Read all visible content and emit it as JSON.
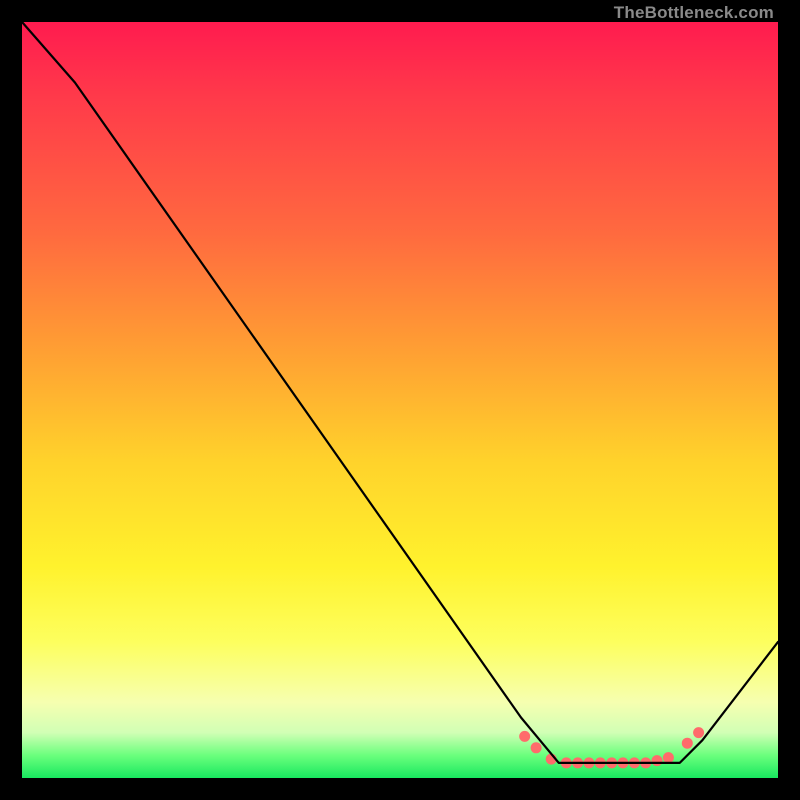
{
  "attribution": "TheBottleneck.com",
  "chart_data": {
    "type": "line",
    "title": "",
    "xlabel": "",
    "ylabel": "",
    "xlim": [
      0,
      100
    ],
    "ylim": [
      0,
      100
    ],
    "series": [
      {
        "name": "bottleneck-curve",
        "x": [
          0,
          7,
          66,
          71,
          87,
          90,
          100
        ],
        "y": [
          100,
          92,
          8,
          2,
          2,
          5,
          18
        ]
      }
    ],
    "highlight": {
      "name": "flat-minimum-dots",
      "x": [
        66.5,
        68,
        70,
        72,
        73.5,
        75,
        76.5,
        78,
        79.5,
        81,
        82.5,
        84,
        85.5,
        88,
        89.5
      ],
      "y": [
        5.5,
        4.0,
        2.5,
        2.0,
        2.0,
        2.0,
        2.0,
        2.0,
        2.0,
        2.0,
        2.0,
        2.3,
        2.7,
        4.6,
        6.0
      ]
    }
  },
  "colors": {
    "curve": "#000000",
    "dots": "#ff6b6b"
  }
}
